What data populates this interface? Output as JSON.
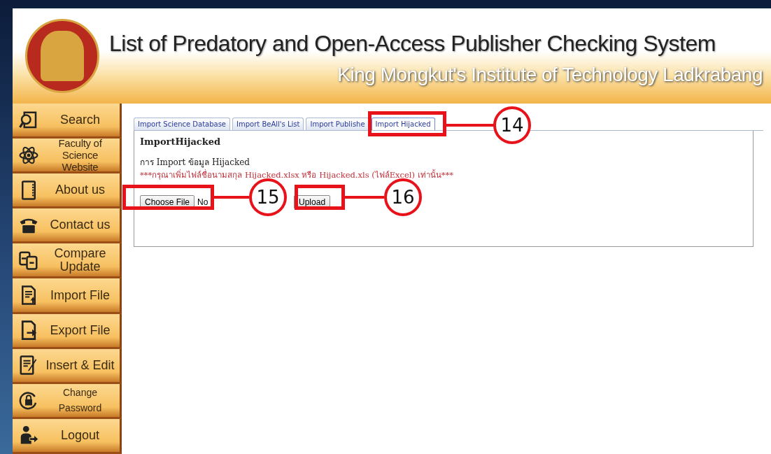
{
  "header": {
    "title": "List of Predatory and Open-Access Publisher Checking System",
    "subtitle": "King Mongkut's Institute of Technology Ladkrabang"
  },
  "sidebar": {
    "items": [
      {
        "label": "Search",
        "kind": "search"
      },
      {
        "label": "Faculty of Science Website",
        "kind": "atom"
      },
      {
        "label": "About us",
        "kind": "notebook"
      },
      {
        "label": "Contact us",
        "kind": "phone"
      },
      {
        "label": "Compare Update",
        "kind": "compare"
      },
      {
        "label": "Import File",
        "kind": "import"
      },
      {
        "label": "Export File",
        "kind": "export"
      },
      {
        "label": "Insert & Edit",
        "kind": "edit"
      },
      {
        "label": "Change Password",
        "kind": "lock"
      },
      {
        "label": "Logout",
        "kind": "logout"
      }
    ]
  },
  "tabs": [
    {
      "label": "Import Science Database",
      "selected": false
    },
    {
      "label": "Import BeAll's List",
      "selected": false
    },
    {
      "label": "Import Publishe",
      "selected": false
    },
    {
      "label": "Import Hijacked",
      "selected": true
    }
  ],
  "panel": {
    "heading": "ImportHijacked",
    "description": "การ Import ข้อมูล Hijacked",
    "warning": "***กรุณาเพิ่มไฟล์ชื่อนามสกุล Hijacked.xlsx หรือ Hijacked.xls (ไฟล์Excel) เท่านั้น***",
    "choose_button": "Choose File",
    "file_status": "No",
    "upload_button": "Upload"
  },
  "callouts": [
    "14",
    "15",
    "16"
  ]
}
